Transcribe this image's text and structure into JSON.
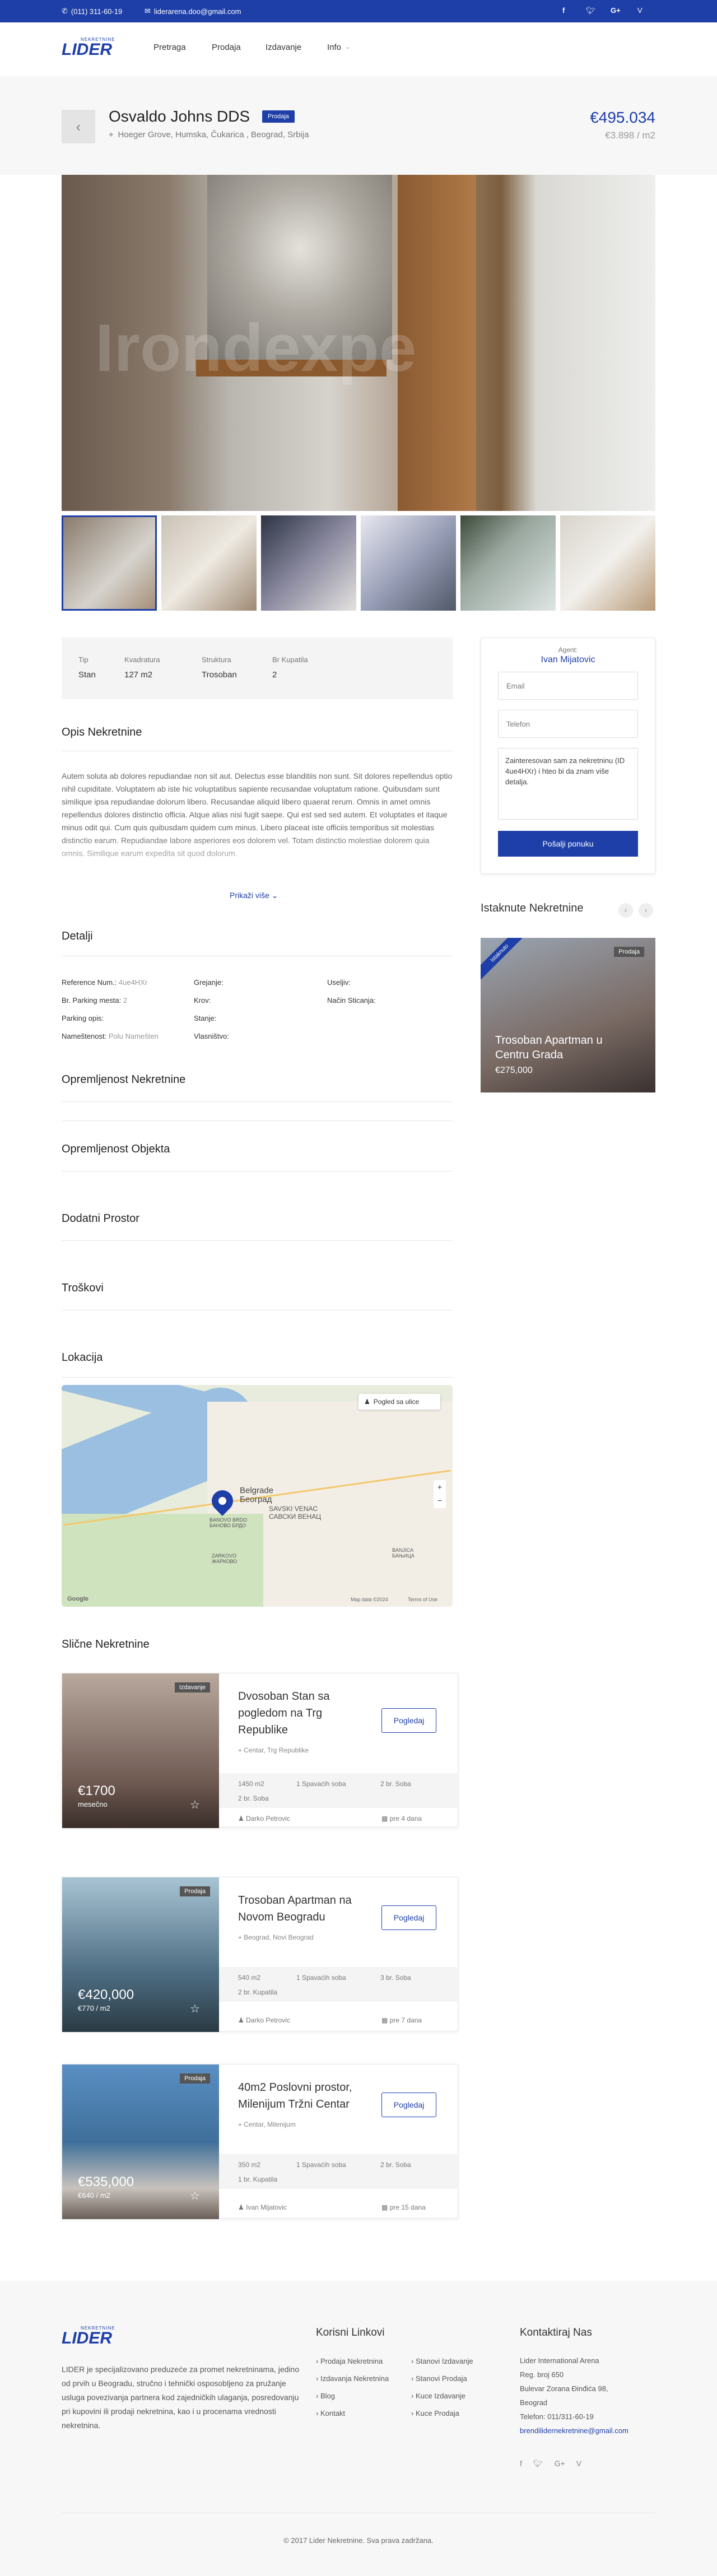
{
  "topbar": {
    "phone": "(011) 311-60-19",
    "email": "liderarena.doo@gmail.com"
  },
  "brand": {
    "logo_small": "NEKRETNINE",
    "logo_big": "LIDER",
    "accent": "#1e3fa8"
  },
  "nav": {
    "items": [
      "Pretraga",
      "Prodaja",
      "Izdavanje",
      "Info"
    ]
  },
  "property": {
    "title": "Osvaldo Johns DDS",
    "badge": "Prodaja",
    "address": "Hoeger Grove, Humska, Čukarica , Beograd, Srbija",
    "price": "€495.034",
    "price_m2": "€3.898 / m2"
  },
  "overview": {
    "labels": [
      "Tip",
      "Kvadratura",
      "Struktura",
      "Br Kupatila"
    ],
    "values": [
      "Stan",
      "127 m2",
      "Trosoban",
      "2"
    ]
  },
  "description": {
    "title": "Opis Nekretnine",
    "text": "Autem soluta ab dolores repudiandae non sit aut. Delectus esse blanditiis non sunt. Sit dolores repellendus optio nihil cupiditate. Voluptatem ab iste hic voluptatibus sapiente recusandae voluptatum ratione. Quibusdam sunt similique ipsa repudiandae dolorum libero. Recusandae aliquid libero quaerat rerum. Omnis in amet omnis repellendus dolores distinctio officia. Atque alias nisi fugit saepe. Qui est sed sed autem. Et voluptates et itaque minus odit qui. Cum quis quibusdam quidem cum minus. Libero placeat iste officiis temporibus sit molestias distinctio earum. Repudiandae labore asperiores eos dolorem vel. Totam distinctio molestiae dolorem quia omnis. Similique earum expedita sit quod dolorum.",
    "more": "Prikaži više"
  },
  "details": {
    "title": "Detalji",
    "col1": [
      [
        "Reference Num.:",
        "4ue4HXr"
      ],
      [
        "Br. Parking mesta:",
        "2"
      ],
      [
        "Parking opis:",
        ""
      ],
      [
        "Nameštenost:",
        "Polu Namešten"
      ]
    ],
    "col2": [
      [
        "Grejanje:",
        ""
      ],
      [
        "Krov:",
        ""
      ],
      [
        "Stanje:",
        ""
      ],
      [
        "Vlasništvo:",
        ""
      ]
    ],
    "col3": [
      [
        "Useljiv:",
        ""
      ],
      [
        "Način Sticanja:",
        ""
      ]
    ]
  },
  "sections": [
    "Opremljenost Nekretnine",
    "Opremljenost Objekta",
    "Dodatni Prostor",
    "Troškovi"
  ],
  "location": {
    "title": "Lokacija",
    "street_view": "Pogled sa ulice",
    "map_data": "Map data ©2024",
    "terms": "Terms of Use",
    "places": [
      "Belgrade",
      "Београд",
      "SAVSKI VENAC",
      "САВСКИ ВЕНАЦ",
      "BANOVO BRDO",
      "БАНОВО БРДО",
      "ZARKOVO",
      "ЖАРКОВО",
      "BANJICA",
      "БАЊИЦА"
    ]
  },
  "agent": {
    "label": "Agent:",
    "name": "Ivan Mijatovic",
    "email_ph": "Email",
    "phone_ph": "Telefon",
    "message": "Zainteresovan sam za nekretninu (ID 4ue4HXr) i hteo bi da znam više detalja.",
    "submit": "Pošalji ponuku"
  },
  "featured": {
    "title": "Istaknute Nekretnine",
    "ribbon": "Istaknuto",
    "tag": "Prodaja",
    "name": "Trosoban Apartman u Centru Grada",
    "price": "€275,000"
  },
  "similar": {
    "title": "Slične Nekretnine",
    "button": "Pogledaj",
    "items": [
      {
        "tag": "Izdavanje",
        "price": "€1700",
        "sub": "mesečno",
        "title": "Dvosoban Stan sa pogledom na Trg Republike",
        "location": "Centar, Trg Republike",
        "feats": [
          "1450 m2",
          "1 Spavaćih soba",
          "2 br. Soba",
          "2 br. Soba"
        ],
        "agent": "Darko Petrovic",
        "date": "pre 4 dana",
        "color": "#6f5a52"
      },
      {
        "tag": "Prodaja",
        "price": "€420,000",
        "sub": "€770 / m2",
        "title": "Trosoban Apartman na Novom Beogradu",
        "location": "Beograd, Novi Beograd",
        "feats": [
          "540 m2",
          "1 Spavaćih soba",
          "3 br. Soba",
          "2 br. Kupatila"
        ],
        "agent": "Darko Petrovic",
        "date": "pre 7 dana",
        "color": "#4f6f84"
      },
      {
        "tag": "Prodaja",
        "price": "€535,000",
        "sub": "€640 / m2",
        "title": "40m2 Poslovni prostor, Milenijum Tržni Centar",
        "location": "Centar, Milenijum",
        "feats": [
          "350 m2",
          "1 Spavaćih soba",
          "2 br. Soba",
          "1 br. Kupatila"
        ],
        "agent": "Ivan Mijatovic",
        "date": "pre 15 dana",
        "color": "#3f6f9a"
      }
    ]
  },
  "footer": {
    "about": "LIDER je specijalizovano preduzeće za promet nekretninama, jedino od prvih u Beogradu, stručno i tehnički osposobljeno za pružanje usluga povezivanja partnera kod zajedničkih ulaganja, posredovanju pri kupovini ili prodaji nekretnina, kao i u procenama vrednosti nekretnina.",
    "links_title": "Korisni Linkovi",
    "links_a": [
      "Prodaja Nekretnina",
      "Izdavanja Nekretnina",
      "Blog",
      "Kontakt"
    ],
    "links_b": [
      "Stanovi Izdavanje",
      "Stanovi Prodaja",
      "Kuce Izdavanje",
      "Kuce Prodaja"
    ],
    "contact_title": "Kontaktiraj Nas",
    "contact": [
      "Lider International Arena",
      "Reg. broj 650",
      "Bulevar Zorana Đinđića 98,",
      "Beograd",
      "Telefon: 011/311-60-19"
    ],
    "email": "brendilidernekretnine@gmail.com",
    "copyright": "© 2017 Lider Nekretnine. Sva prava zadržana."
  }
}
